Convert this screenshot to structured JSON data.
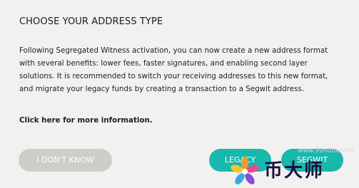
{
  "dialog": {
    "title": "CHOOSE YOUR ADDRESS TYPE",
    "description": "Following Segregated Witness activation, you can now create a new address format with several benefits: lower fees, faster signatures, and enabling second layer solutions. It is recommended to switch your receiving addresses to this new format, and migrate your legacy funds by creating a transaction to a Segwit address.",
    "more_info_link": "Click here for more information.",
    "buttons": {
      "dont_know": "I DON'T KNOW",
      "legacy": "LEGACY",
      "segwit": "SEGWIT"
    }
  },
  "watermark": {
    "url": "www.99hufu.com",
    "brand": "币大师",
    "logo_icon": "flower-logo-icon"
  },
  "colors": {
    "dialog_background": "#f1f1f0",
    "primary_button": "#19b8ac",
    "secondary_button": "#cfcdc7"
  }
}
